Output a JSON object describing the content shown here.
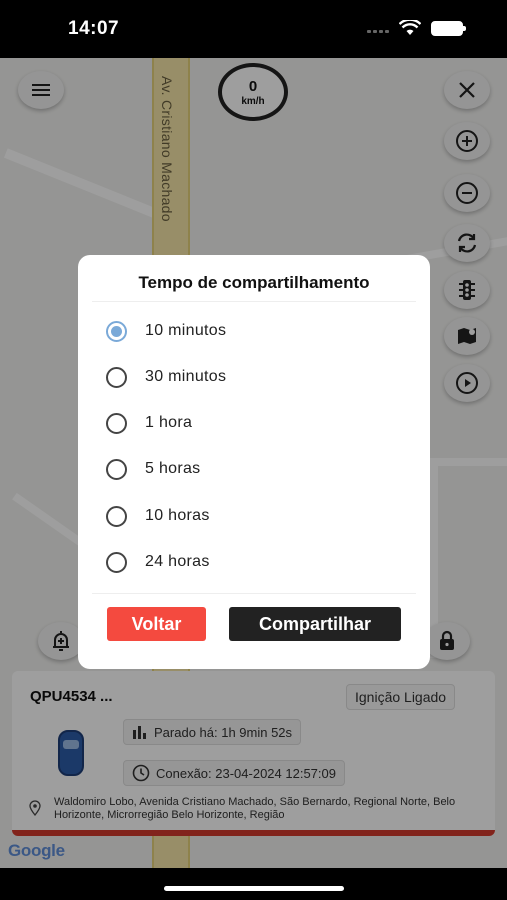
{
  "status": {
    "time": "14:07"
  },
  "map": {
    "street_label": "Av. Cristiano Machado",
    "speed_value": "0",
    "speed_unit": "km/h",
    "google_label": "Google"
  },
  "dialog": {
    "title": "Tempo de compartilhamento",
    "options": [
      {
        "label": "10 minutos",
        "selected": true
      },
      {
        "label": "30 minutos",
        "selected": false
      },
      {
        "label": "1 hora",
        "selected": false
      },
      {
        "label": "5 horas",
        "selected": false
      },
      {
        "label": "10 horas",
        "selected": false
      },
      {
        "label": "24 horas",
        "selected": false
      }
    ],
    "back_label": "Voltar",
    "share_label": "Compartilhar"
  },
  "vehicle": {
    "plate": "QPU4534 ...",
    "ignition": "Ignição Ligado",
    "stopped": "Parado há: 1h 9min 52s",
    "connection": "Conexão: 23-04-2024 12:57:09",
    "address": "Waldomiro Lobo, Avenida Cristiano Machado, São Bernardo, Regional Norte, Belo Horizonte, Microrregião Belo Horizonte, Região"
  },
  "colors": {
    "accent_red": "#f44a3f",
    "radio_selected": "#7aa9d8",
    "dark_button": "#222222"
  },
  "icons": [
    "menu-icon",
    "close-icon",
    "zoom-in-icon",
    "zoom-out-icon",
    "refresh-icon",
    "traffic-light-icon",
    "map-layers-icon",
    "play-icon",
    "alarm-add-icon",
    "lock-icon",
    "bar-chart-icon",
    "clock-icon",
    "pin-icon"
  ]
}
